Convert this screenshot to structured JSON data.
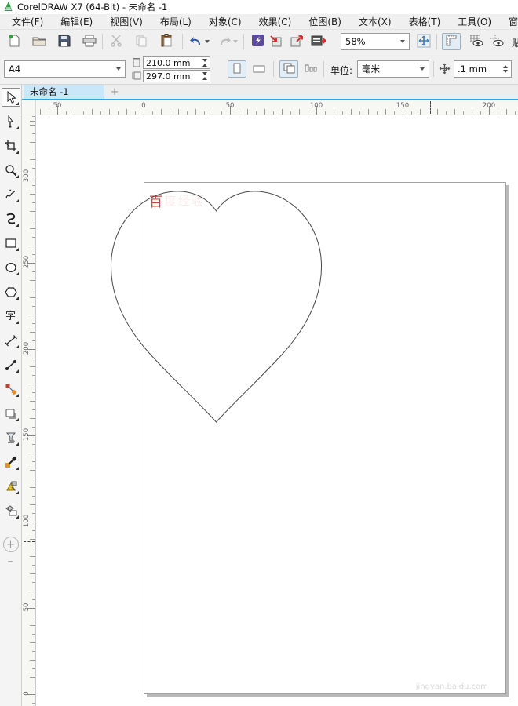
{
  "window": {
    "title": "CorelDRAW X7 (64-Bit) - 未命名 -1"
  },
  "menu": {
    "items": [
      "文件(F)",
      "编辑(E)",
      "视图(V)",
      "布局(L)",
      "对象(C)",
      "效果(C)",
      "位图(B)",
      "文本(X)",
      "表格(T)",
      "工具(O)",
      "窗口(W)"
    ]
  },
  "toolbar": {
    "zoom_level": "58%",
    "snap_partial": "贴"
  },
  "property_bar": {
    "preset": "A4",
    "page_width": "210.0 mm",
    "page_height": "297.0 mm",
    "units_label": "单位:",
    "units_value": "毫米",
    "nudge_value": ".1 mm"
  },
  "document": {
    "tab_label": "未命名 -1",
    "new_tab_label": "+"
  },
  "rulers": {
    "horizontal": [
      "50",
      "0",
      "50",
      "100",
      "150",
      "200"
    ],
    "vertical": [
      "300",
      "250",
      "200",
      "150",
      "100",
      "50",
      "0"
    ]
  },
  "toolbox": {
    "text_tool_glyph": "字",
    "add_tool_glyph": "+",
    "overflow_glyph": "┄"
  },
  "page": {
    "watermark_top": "百",
    "watermark_top_ghost": "度经验",
    "watermark_bottom": "jingyan.baidu.com"
  },
  "canvas_object": {
    "type": "heart-outline",
    "stroke": "#4a4a4a"
  }
}
